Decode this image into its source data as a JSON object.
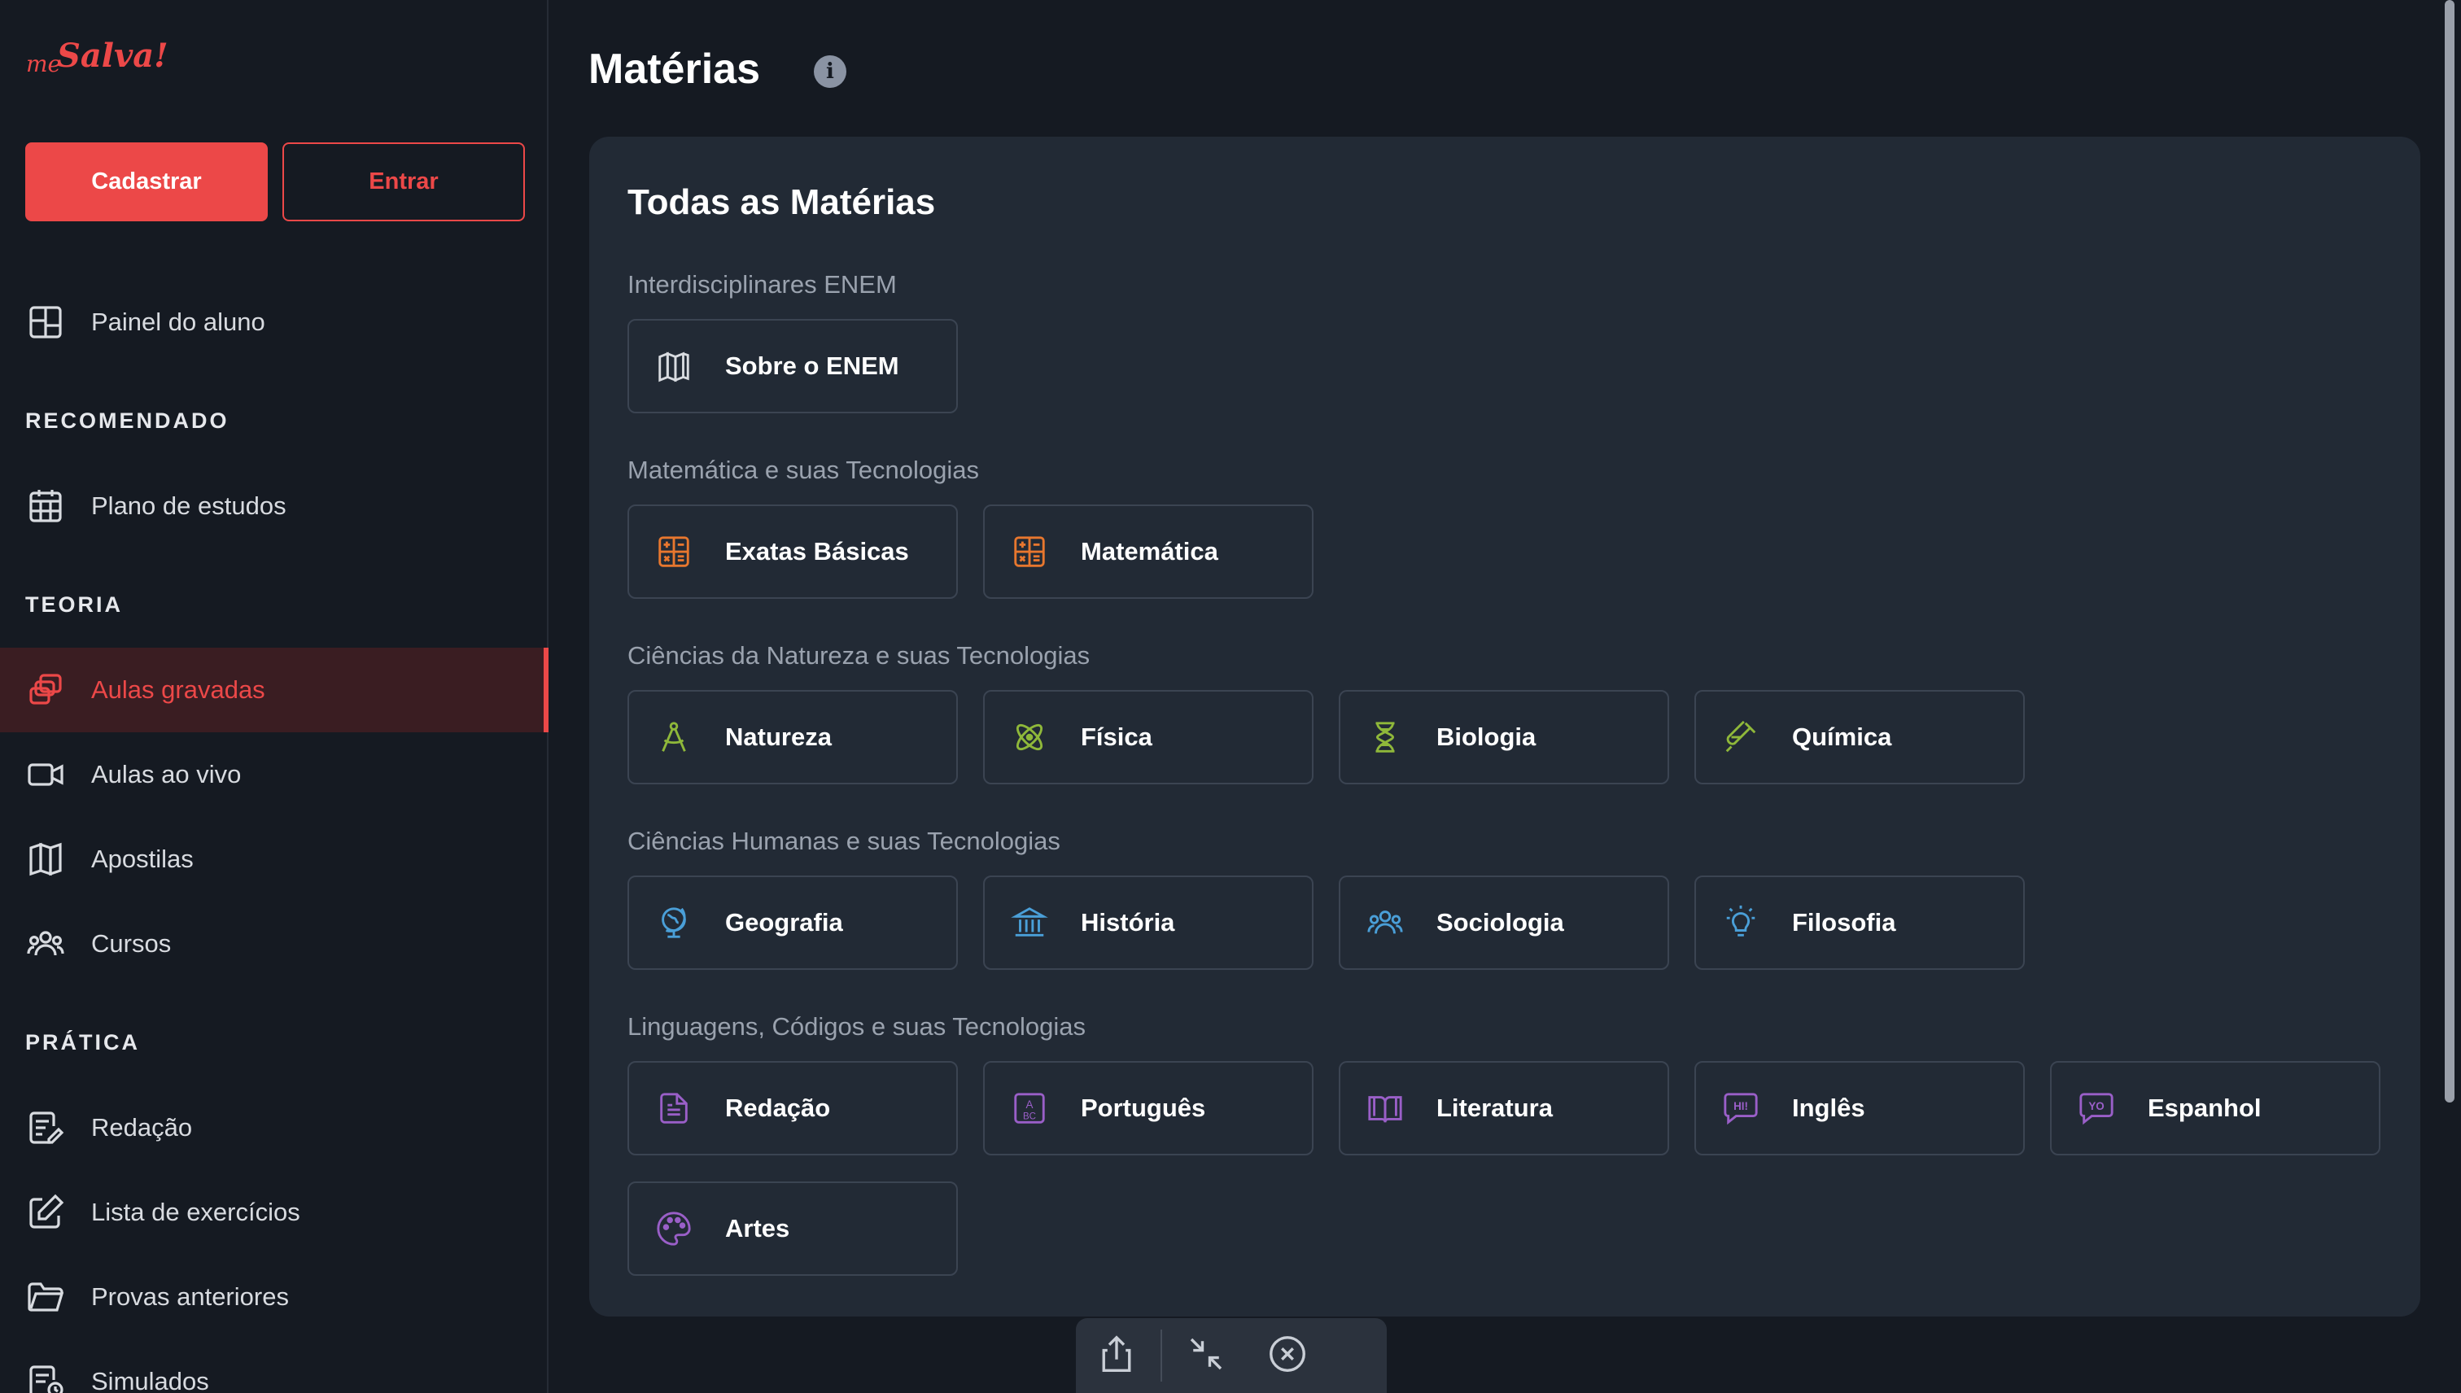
{
  "brand": {
    "logo_me": "me",
    "logo_salva": "Salva!"
  },
  "auth": {
    "signup_label": "Cadastrar",
    "login_label": "Entrar"
  },
  "sidebar": {
    "items": [
      {
        "label": "Painel do aluno",
        "icon": "dashboard-icon"
      },
      {
        "label": "Plano de estudos",
        "icon": "calendar-icon"
      },
      {
        "label": "Aulas gravadas",
        "icon": "recorded-lessons-icon",
        "active": true
      },
      {
        "label": "Aulas ao vivo",
        "icon": "video-camera-icon"
      },
      {
        "label": "Apostilas",
        "icon": "book-open-icon"
      },
      {
        "label": "Cursos",
        "icon": "users-icon"
      },
      {
        "label": "Redação",
        "icon": "document-pen-icon"
      },
      {
        "label": "Lista de exercícios",
        "icon": "edit-icon"
      },
      {
        "label": "Provas anteriores",
        "icon": "folder-icon"
      },
      {
        "label": "Simulados",
        "icon": "exam-icon"
      }
    ],
    "sections": {
      "recommended": "RECOMENDADO",
      "theory": "TEORIA",
      "practice": "PRÁTICA"
    }
  },
  "main": {
    "title": "Matérias",
    "card_title": "Todas as Matérias",
    "groups": [
      {
        "label": "Interdisciplinares ENEM",
        "subjects": [
          {
            "label": "Sobre o ENEM",
            "icon": "book-icon"
          }
        ]
      },
      {
        "label": "Matemática e suas Tecnologias",
        "subjects": [
          {
            "label": "Exatas Básicas",
            "icon": "calculator-icon"
          },
          {
            "label": "Matemática",
            "icon": "calculator-icon"
          }
        ]
      },
      {
        "label": "Ciências da Natureza e suas Tecnologias",
        "subjects": [
          {
            "label": "Natureza",
            "icon": "compass-icon"
          },
          {
            "label": "Física",
            "icon": "atom-icon"
          },
          {
            "label": "Biologia",
            "icon": "dna-icon"
          },
          {
            "label": "Química",
            "icon": "test-tube-icon"
          }
        ]
      },
      {
        "label": "Ciências Humanas e suas Tecnologias",
        "subjects": [
          {
            "label": "Geografia",
            "icon": "globe-icon"
          },
          {
            "label": "História",
            "icon": "museum-icon"
          },
          {
            "label": "Sociologia",
            "icon": "people-icon"
          },
          {
            "label": "Filosofia",
            "icon": "lightbulb-icon"
          }
        ]
      },
      {
        "label": "Linguagens, Códigos e suas Tecnologias",
        "subjects": [
          {
            "label": "Redação",
            "icon": "document-icon"
          },
          {
            "label": "Português",
            "icon": "abc-icon"
          },
          {
            "label": "Literatura",
            "icon": "open-book-icon"
          },
          {
            "label": "Inglês",
            "icon": "speech-hi-icon"
          },
          {
            "label": "Espanhol",
            "icon": "speech-yo-icon"
          },
          {
            "label": "Artes",
            "icon": "palette-icon"
          }
        ]
      }
    ]
  },
  "colors": {
    "accent": "#ec4848",
    "math": "#e8772e",
    "nature": "#8fb83a",
    "humanities": "#4a9fd8",
    "languages": "#9a5fc8"
  },
  "toolbar": {
    "share_icon": "share-icon",
    "minimize_icon": "minimize-icon",
    "close_icon": "close-circle-icon"
  },
  "icon_glyphs": {
    "info": "i",
    "hi": "HI!",
    "yo": "YO",
    "abc_a": "A",
    "abc_bc": "BC"
  }
}
